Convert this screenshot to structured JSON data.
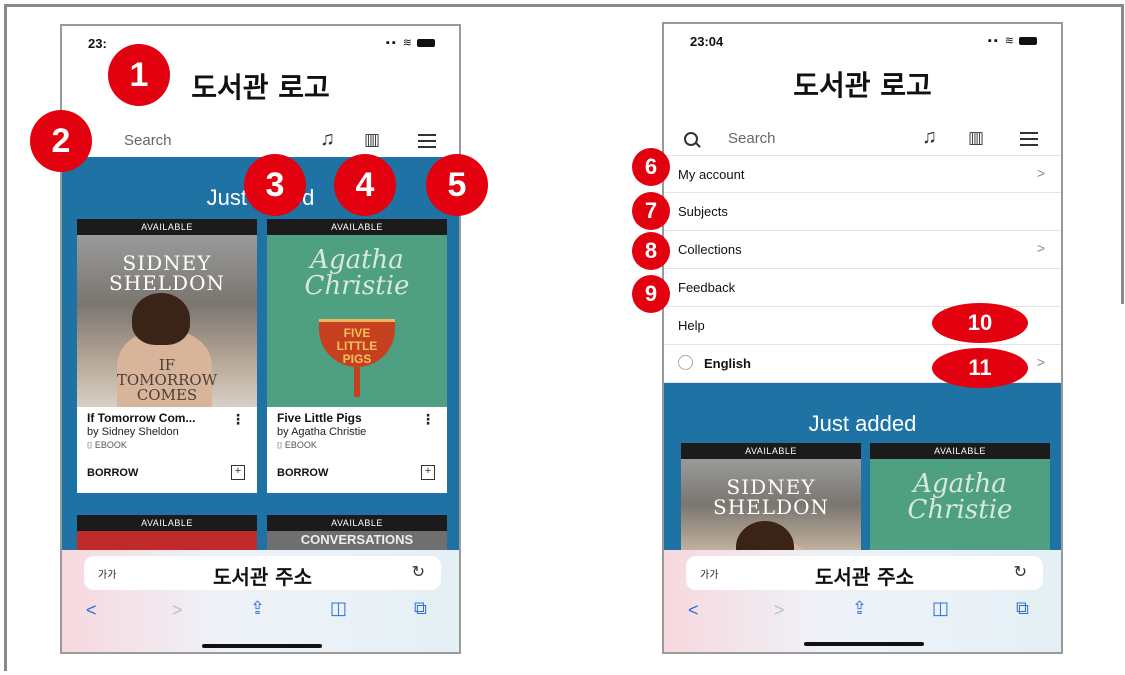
{
  "left_phone": {
    "status_time": "23:",
    "logo_title": "도서관 로고",
    "search_placeholder": "Search",
    "section_title": "Just added",
    "books": [
      {
        "availability": "AVAILABLE",
        "cover_author": "SIDNEY\nSHELDON",
        "cover_title": "IF\nTOMORROW\nCOMES",
        "title": "If Tomorrow Com...",
        "author": "by Sidney Sheldon",
        "format": "EBOOK",
        "action": "BORROW"
      },
      {
        "availability": "AVAILABLE",
        "cover_author": "Agatha\nChristie",
        "cover_title": "FIVE\nLITTLE\nPIGS",
        "title": "Five Little Pigs",
        "author": "by Agatha Christie",
        "format": "EBOOK",
        "action": "BORROW"
      }
    ],
    "more_books": [
      {
        "availability": "AVAILABLE"
      },
      {
        "availability": "AVAILABLE",
        "cover_title": "CONVERSATIONS"
      }
    ],
    "url_text": "도서관 주소",
    "text_size_label": "가가"
  },
  "right_phone": {
    "status_time": "23:04",
    "logo_title": "도서관 로고",
    "search_placeholder": "Search",
    "menu_items": [
      {
        "label": "My account",
        "chevron": true
      },
      {
        "label": "Subjects",
        "chevron": false
      },
      {
        "label": "Collections",
        "chevron": true
      },
      {
        "label": "Feedback",
        "chevron": false
      },
      {
        "label": "Help",
        "chevron": false
      },
      {
        "label": "English",
        "chevron": true
      }
    ],
    "section_title": "Just added",
    "books": [
      {
        "availability": "AVAILABLE",
        "cover_author": "SIDNEY\nSHELDON"
      },
      {
        "availability": "AVAILABLE",
        "cover_author": "Agatha\nChristie"
      }
    ],
    "url_text": "도서관 주소",
    "text_size_label": "가가"
  },
  "badges": [
    "1",
    "2",
    "3",
    "4",
    "5",
    "6",
    "7",
    "8",
    "9",
    "10",
    "11"
  ],
  "colors": {
    "badge": "#e3000f",
    "blue_section": "#1e73a4",
    "nav_blue": "#2f6fd8"
  }
}
